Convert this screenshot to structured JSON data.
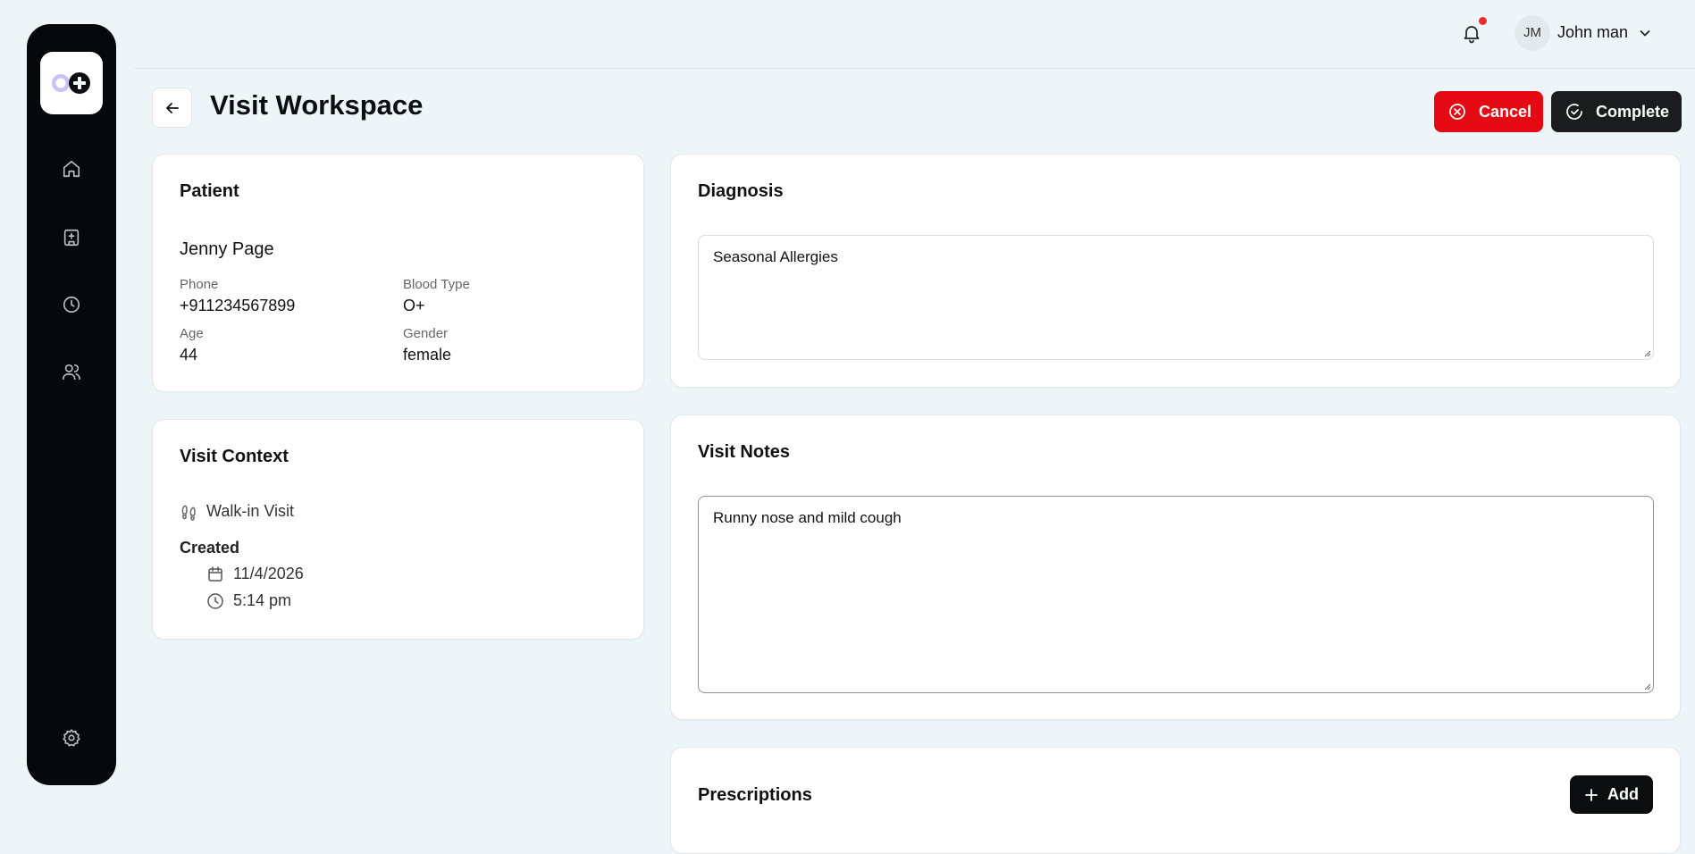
{
  "header": {
    "user_initials": "JM",
    "user_name": "John man",
    "notification_dot_color": "#ef2b2b"
  },
  "sidebar": {
    "items": [
      {
        "icon": "home-icon"
      },
      {
        "icon": "hospital-icon"
      },
      {
        "icon": "clock-icon"
      },
      {
        "icon": "users-icon"
      }
    ],
    "footer_icon": "settings-icon"
  },
  "page": {
    "title": "Visit Workspace",
    "cancel_label": "Cancel",
    "complete_label": "Complete"
  },
  "patient": {
    "section_title": "Patient",
    "name": "Jenny Page",
    "phone_label": "Phone",
    "phone": "+911234567899",
    "blood_type_label": "Blood Type",
    "blood_type": "O+",
    "age_label": "Age",
    "age": "44",
    "gender_label": "Gender",
    "gender": "female"
  },
  "visit_context": {
    "section_title": "Visit Context",
    "visit_type": "Walk-in Visit",
    "created_label": "Created",
    "date": "11/4/2026",
    "time": "5:14 pm"
  },
  "diagnosis": {
    "section_title": "Diagnosis",
    "value": "Seasonal Allergies"
  },
  "visit_notes": {
    "section_title": "Visit Notes",
    "value": "Runny nose and mild cough"
  },
  "prescriptions": {
    "section_title": "Prescriptions",
    "add_label": "Add"
  },
  "colors": {
    "sidebar_bg": "#05090c",
    "cancel_bg": "#e50914",
    "complete_bg": "#1a1c1e",
    "page_bg": "#eef5f8"
  }
}
